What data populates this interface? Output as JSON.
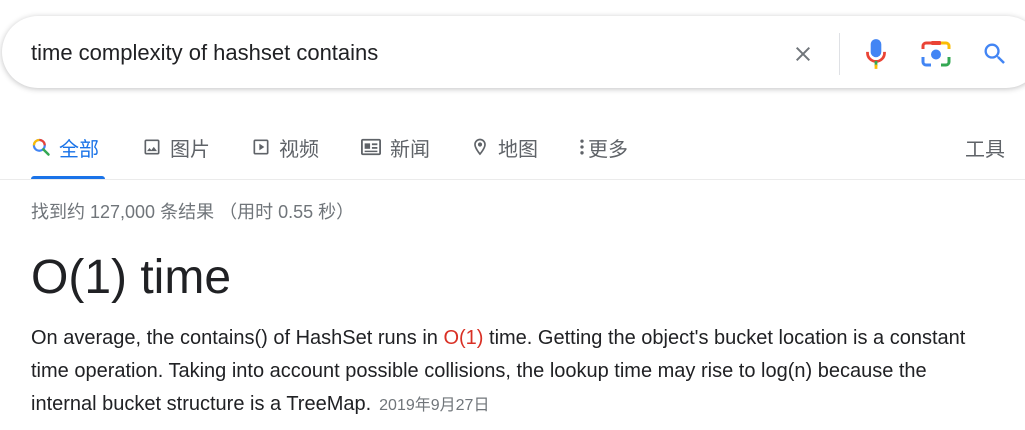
{
  "search": {
    "query": "time complexity of hashset contains"
  },
  "tabs": [
    {
      "label": "全部",
      "icon": "search-icon",
      "active": true
    },
    {
      "label": "图片",
      "icon": "image-icon"
    },
    {
      "label": "视频",
      "icon": "video-play-icon"
    },
    {
      "label": "新闻",
      "icon": "news-icon"
    },
    {
      "label": "地图",
      "icon": "map-pin-icon"
    },
    {
      "label": "更多",
      "icon": "more-vert-icon"
    }
  ],
  "tools_label": "工具",
  "result_stats": "找到约 127,000 条结果 （用时 0.55 秒）",
  "answer": {
    "title": "O(1) time",
    "snippet_before": "On average, the contains() of HashSet runs in ",
    "snippet_highlight": "O(1)",
    "snippet_after": " time. Getting the object's bucket location is a constant time operation. Taking into account possible collisions, the lookup time may rise to log(n) because the internal bucket structure is a TreeMap.",
    "date": "2019年9月27日"
  },
  "colors": {
    "accent": "#1a73e8",
    "highlight": "#d93025",
    "muted": "#70757a",
    "text": "#202124"
  }
}
